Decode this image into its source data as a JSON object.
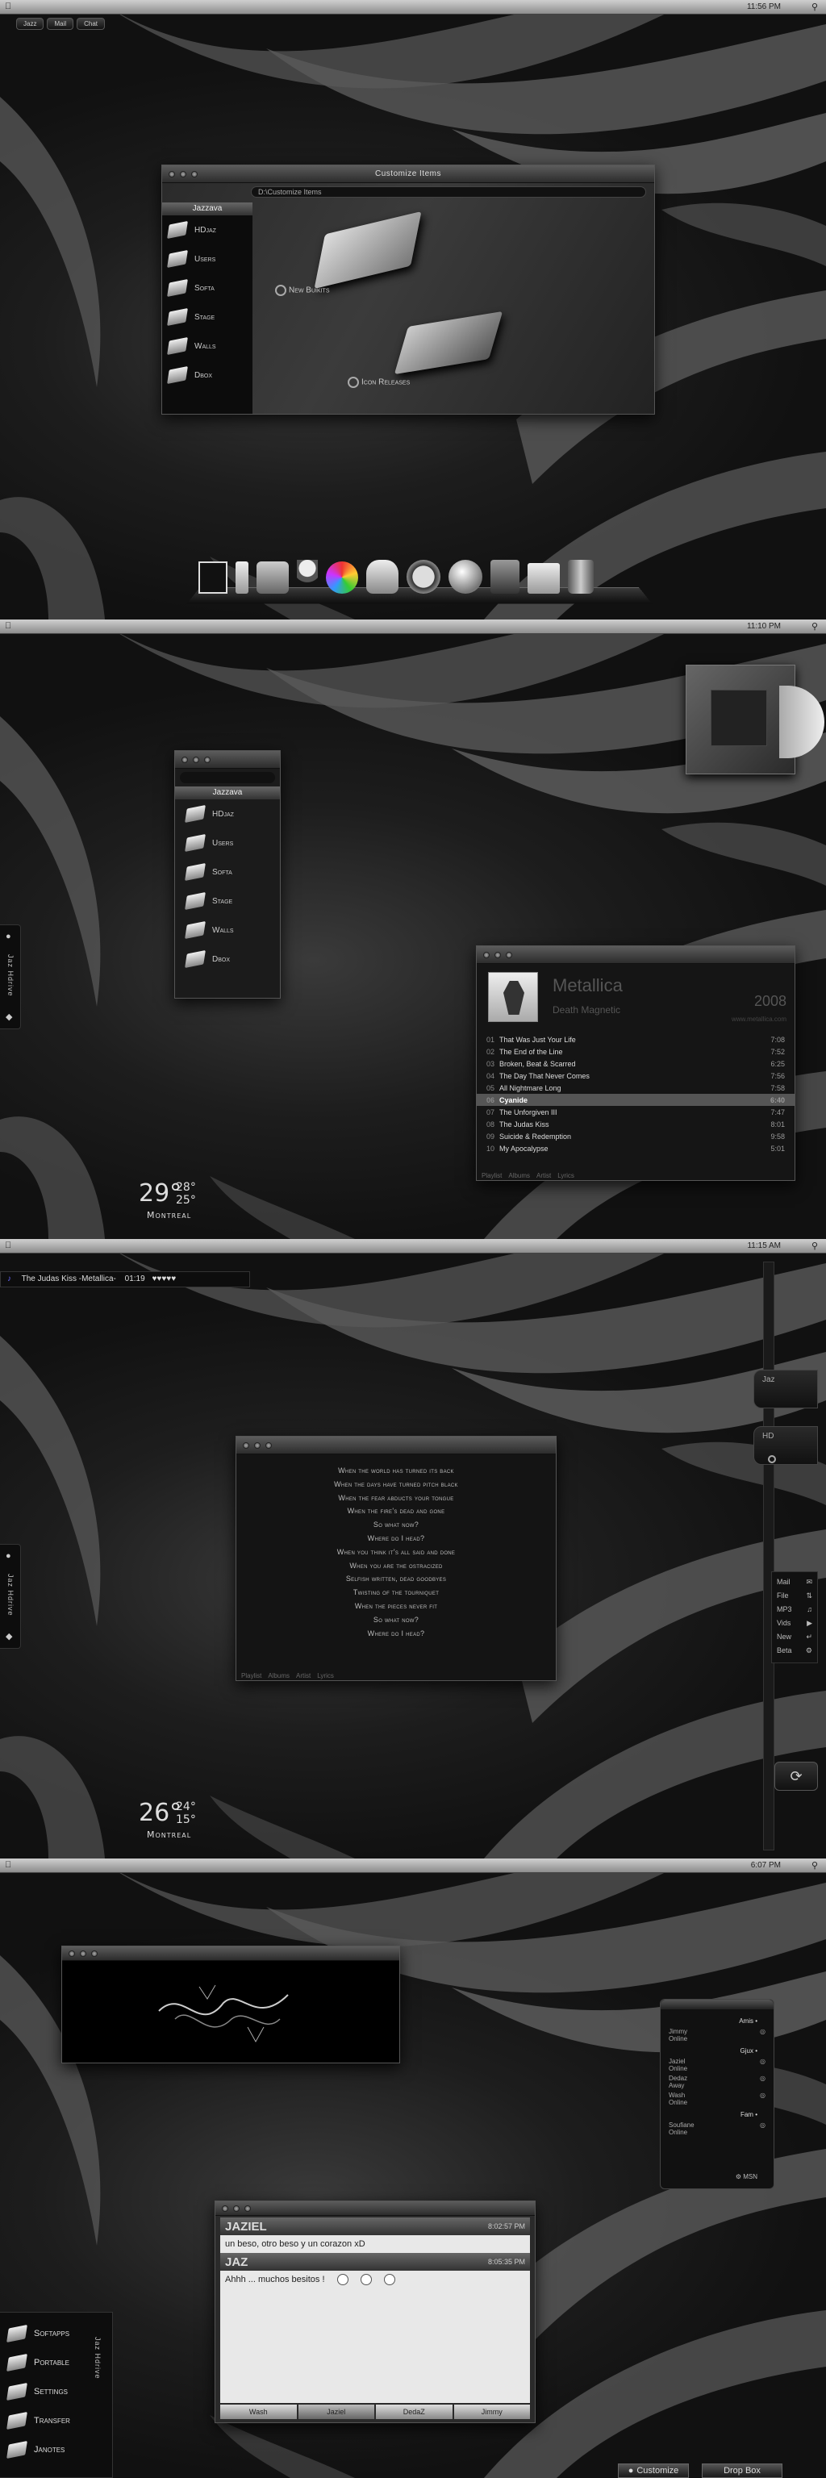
{
  "panel1": {
    "menu_tabs": [
      "Jazz",
      "Mail",
      "Chat"
    ],
    "clock": "11:56 PM",
    "customize": {
      "title": "Customize Items",
      "path": "D:\\Customize Items",
      "sidebar_header": "Jazzava",
      "items": [
        "HDjaz",
        "Users",
        "Softa",
        "Stage",
        "Walls",
        "Dbox"
      ],
      "folders": [
        "New Buikits",
        "Icon Releases"
      ]
    }
  },
  "panel2": {
    "clock": "11:10 PM",
    "sidebar_header": "Jazzava",
    "items": [
      "HDjaz",
      "Users",
      "Softa",
      "Stage",
      "Walls",
      "Dbox"
    ],
    "side_label": "Jaz Hdrive",
    "weather": {
      "temp": "29°",
      "hi": "28°",
      "lo": "25°",
      "city": "Montreal"
    },
    "player": {
      "artist": "Metallica",
      "album": "Death Magnetic",
      "year": "2008",
      "url": "www.metallica.com",
      "tracks": [
        {
          "n": "01",
          "t": "That Was Just Your Life",
          "d": "7:08"
        },
        {
          "n": "02",
          "t": "The End of the Line",
          "d": "7:52"
        },
        {
          "n": "03",
          "t": "Broken, Beat & Scarred",
          "d": "6:25"
        },
        {
          "n": "04",
          "t": "The Day That Never Comes",
          "d": "7:56"
        },
        {
          "n": "05",
          "t": "All Nightmare Long",
          "d": "7:58"
        },
        {
          "n": "06",
          "t": "Cyanide",
          "d": "6:40"
        },
        {
          "n": "07",
          "t": "The Unforgiven III",
          "d": "7:47"
        },
        {
          "n": "08",
          "t": "The Judas Kiss",
          "d": "8:01"
        },
        {
          "n": "09",
          "t": "Suicide & Redemption",
          "d": "9:58"
        },
        {
          "n": "10",
          "t": "My Apocalypse",
          "d": "5:01"
        }
      ],
      "tabs": [
        "Playlist",
        "Albums",
        "Artist",
        "Lyrics"
      ]
    }
  },
  "panel3": {
    "clock": "11:15 AM",
    "now_playing": "The Judas Kiss -Metallica-",
    "time": "01:19",
    "lyrics": [
      "When the world has turned its back",
      "When the days have turned pitch black",
      "When the fear abducts your tongue",
      "When the fire's dead and gone",
      "So what now?",
      "Where do I head?",
      "When you think it's all said and done",
      "When you are the ostracized",
      "Selfish written, dead goodbyes",
      "Twisting of the tourniquet",
      "When the pieces never fit",
      "So what now?",
      "Where do I head?"
    ],
    "tabs": [
      "Playlist",
      "Albums",
      "Artist",
      "Lyrics"
    ],
    "side_label": "Jaz Hdrive",
    "weather": {
      "temp": "26°",
      "hi": "24°",
      "lo": "15°",
      "city": "Montreal"
    },
    "right_labels": [
      "Jaz",
      "HD"
    ],
    "right_menu": [
      "Mail",
      "File",
      "MP3",
      "Vids",
      "New",
      "Beta"
    ]
  },
  "panel4": {
    "clock": "6:07 PM",
    "buddy": {
      "groups": [
        {
          "name": "Amis",
          "contacts": [
            {
              "name": "Jimmy",
              "status": "Online"
            }
          ]
        },
        {
          "name": "Gjux",
          "contacts": [
            {
              "name": "Jaziel",
              "status": "Online"
            },
            {
              "name": "Dedaz",
              "status": "Away"
            },
            {
              "name": "Wash",
              "status": "Online"
            }
          ]
        },
        {
          "name": "Fam",
          "contacts": [
            {
              "name": "Soufiane",
              "status": "Online"
            }
          ]
        }
      ],
      "footer": "MSN"
    },
    "chat": {
      "messages": [
        {
          "from": "JAZIEL",
          "time": "8:02:57 PM",
          "text": "un beso, otro beso y un corazon xD"
        },
        {
          "from": "JAZ",
          "time": "8:05:35 PM",
          "text": "Ahhh ... muchos besitos !"
        }
      ],
      "tabs": [
        "Wash",
        "Jaziel",
        "DedaZ",
        "Jimmy"
      ]
    },
    "left_menu": [
      "Softapps",
      "Portable",
      "Settings",
      "Transfer",
      "Janotes"
    ],
    "side_label": "Jaz Hdrive",
    "bottom_tabs": [
      "Customize",
      "Drop Box"
    ]
  }
}
